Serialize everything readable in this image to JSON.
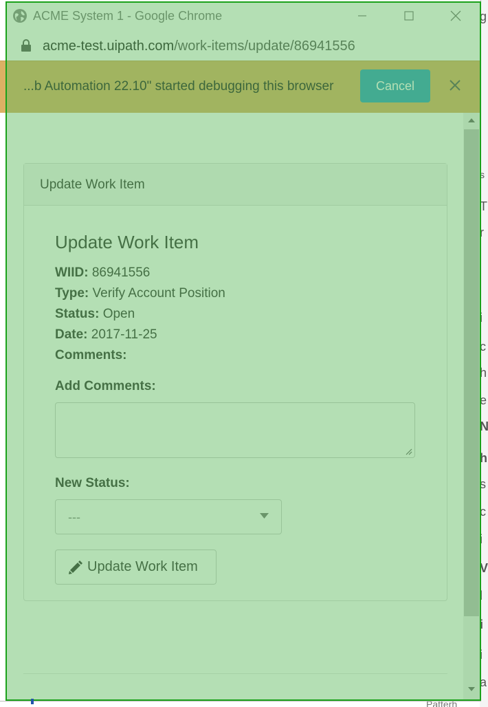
{
  "window": {
    "title": "ACME System 1 - Google Chrome",
    "url_domain": "acme-test.uipath.com",
    "url_path": "/work-items/update/86941556"
  },
  "debug_bar": {
    "message": "...b Automation 22.10\" started debugging this browser",
    "cancel_label": "Cancel"
  },
  "panel": {
    "heading": "Update Work Item",
    "title": "Update Work Item",
    "fields": [
      {
        "label": "WIID:",
        "value": "86941556"
      },
      {
        "label": "Type:",
        "value": "Verify Account Position"
      },
      {
        "label": "Status:",
        "value": "Open"
      },
      {
        "label": "Date:",
        "value": "2017-11-25"
      },
      {
        "label": "Comments:",
        "value": ""
      }
    ],
    "add_comments_label": "Add Comments:",
    "add_comments_value": "",
    "new_status_label": "New Status:",
    "new_status_selected": "---",
    "submit_label": "Update Work Item"
  },
  "background_page": {
    "bottom_text": "Patterh"
  },
  "colors": {
    "highlight": "#5cba5c",
    "highlight_border": "#1aa11a",
    "debug_bar": "#dcb064",
    "cancel_button": "#2f9fbf"
  },
  "icons": {
    "title": "globe-icon",
    "address": "lock-icon",
    "debug_close": "close-icon",
    "submit": "pencil-icon",
    "select": "caret-down-icon"
  }
}
